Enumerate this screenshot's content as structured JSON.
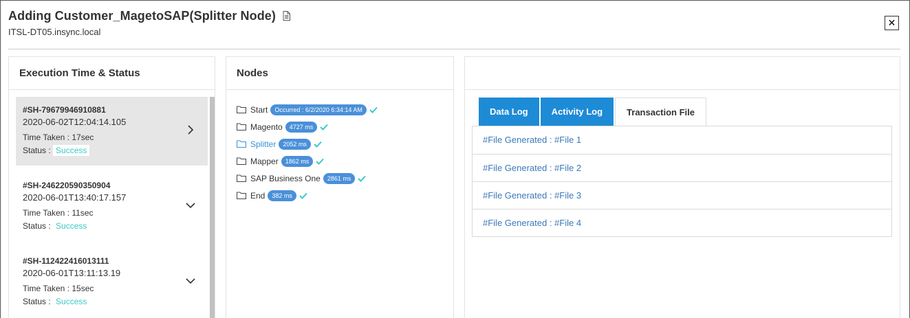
{
  "header": {
    "title": "Adding Customer_MagetoSAP(Splitter Node)",
    "subtitle": "ITSL-DT05.insync.local",
    "close_label": "✕"
  },
  "execution_panel": {
    "title": "Execution Time & Status",
    "items": [
      {
        "id": "#SH-79679946910881",
        "date": "2020-06-02T12:04:14.105",
        "time_label": "Time Taken : ",
        "time_value": "17sec",
        "status_label": "Status : ",
        "status_value": "Success",
        "expanded": false,
        "chevron": "chevron-right-icon"
      },
      {
        "id": "#SH-246220590350904",
        "date": "2020-06-01T13:40:17.157",
        "time_label": "Time Taken : ",
        "time_value": "11sec",
        "status_label": "Status : ",
        "status_value": "Success",
        "chevron": "chevron-down-icon"
      },
      {
        "id": "#SH-112422416013111",
        "date": "2020-06-01T13:11:13.19",
        "time_label": "Time Taken : ",
        "time_value": "15sec",
        "status_label": "Status : ",
        "status_value": "Success",
        "chevron": "chevron-down-icon"
      }
    ]
  },
  "nodes_panel": {
    "title": "Nodes",
    "nodes": [
      {
        "label": "Start",
        "badge": "Occurred : 6/2/2020 6:34:14 AM",
        "link": false
      },
      {
        "label": "Magento",
        "badge": "4727 ms",
        "link": false
      },
      {
        "label": "Splitter",
        "badge": "2052 ms",
        "link": true
      },
      {
        "label": "Mapper",
        "badge": "1862 ms",
        "link": false
      },
      {
        "label": "SAP Business One",
        "badge": "2861 ms",
        "link": false
      },
      {
        "label": "End",
        "badge": "382 ms",
        "link": false
      }
    ]
  },
  "log_panel": {
    "tabs": [
      {
        "label": "Data Log",
        "active": true
      },
      {
        "label": "Activity Log",
        "active": true
      },
      {
        "label": "Transaction File",
        "active": false
      }
    ],
    "files": [
      "#File Generated : #File 1",
      "#File Generated : #File 2",
      "#File Generated : #File 3",
      "#File Generated : #File 4"
    ]
  },
  "colors": {
    "accent": "#1e8bd6",
    "success": "#3cc8c8",
    "badge": "#4a90d9",
    "link": "#3b79b8"
  }
}
